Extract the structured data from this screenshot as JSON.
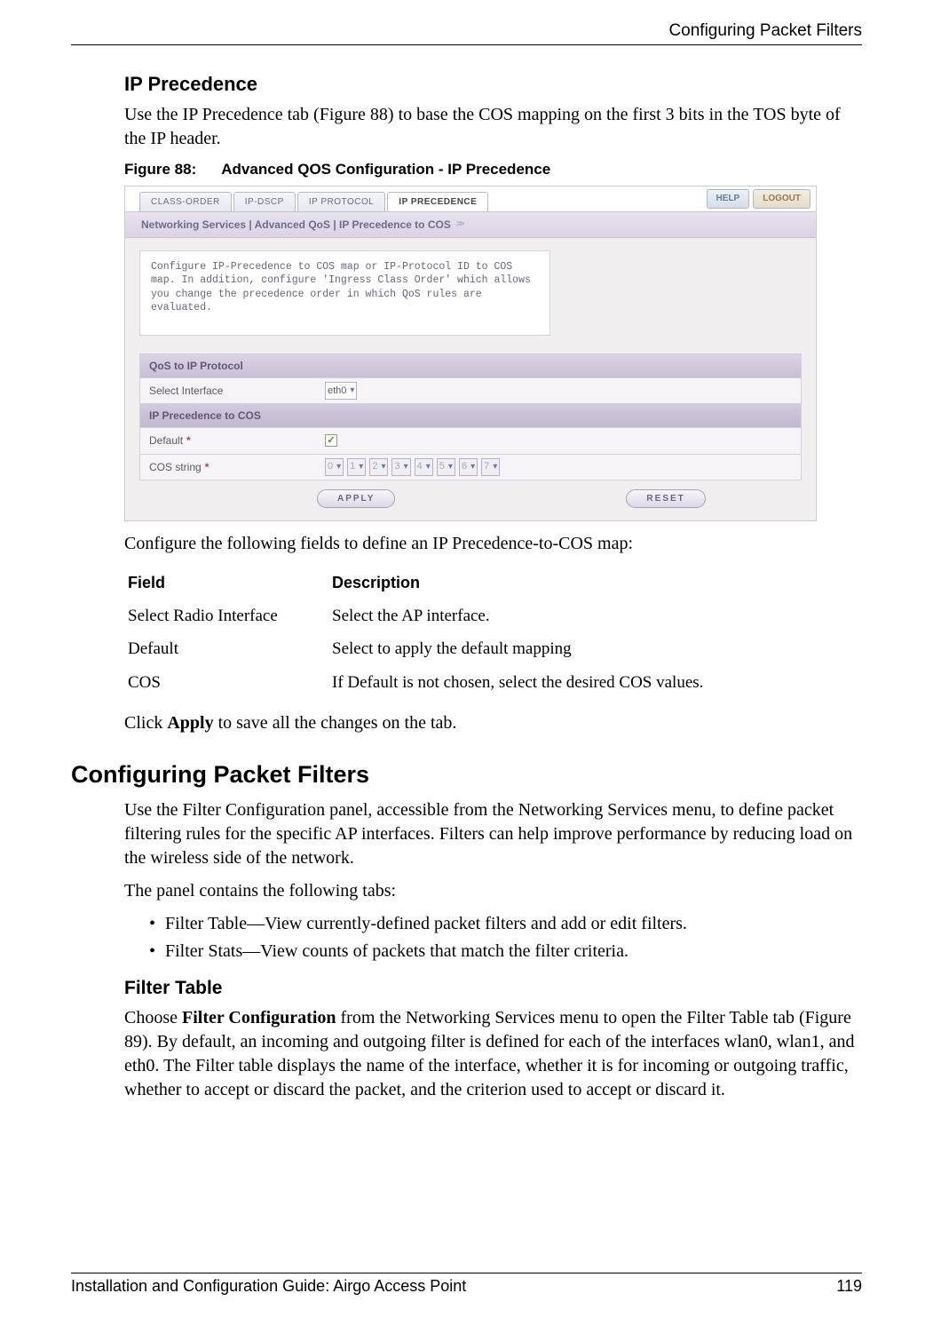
{
  "header": {
    "running_title": "Configuring Packet Filters"
  },
  "ipprec": {
    "heading": "IP Precedence",
    "intro": "Use the IP Precedence tab (Figure 88) to base the COS mapping on the first 3 bits in the TOS byte of the IP header.",
    "fig_no": "Figure 88:",
    "fig_title": "Advanced QOS Configuration - IP Precedence"
  },
  "shot": {
    "tabs": {
      "t1": "CLASS-ORDER",
      "t2": "IP-DSCP",
      "t3": "IP PROTOCOL",
      "t4": "IP PRECEDENCE"
    },
    "help": "HELP",
    "logout": "LOGOUT",
    "crumb": "Networking Services | Advanced QoS | IP Precedence to COS",
    "crumb_arrow": ">>",
    "info": "Configure IP-Precedence to COS map or IP-Protocol ID to COS map. In addition, configure 'Ingress Class Order' which allows you change the precedence order in which QoS rules are evaluated.",
    "sect1": "QoS to IP Protocol",
    "row_iface_label": "Select Interface",
    "row_iface_value": "eth0",
    "sect2": "IP Precedence to COS",
    "row_default_label": "Default",
    "row_cos_label": "COS string",
    "cos_values": [
      "0",
      "1",
      "2",
      "3",
      "4",
      "5",
      "6",
      "7"
    ],
    "apply": "APPLY",
    "reset": "RESET"
  },
  "aftershot": {
    "line": "Configure the following fields to define an IP Precedence-to-COS map:",
    "th_field": "Field",
    "th_desc": "Description",
    "r1f": "Select Radio Interface",
    "r1d": "Select the AP interface.",
    "r2f": "Default",
    "r2d": "Select to apply the default mapping",
    "r3f": "COS",
    "r3d": "If Default is not chosen, select the desired COS values.",
    "apply_line_pre": "Click ",
    "apply_bold": "Apply",
    "apply_line_post": " to save all the changes on the tab."
  },
  "cpf": {
    "heading": "Configuring Packet Filters",
    "p1": "Use the Filter Configuration panel, accessible from the Networking Services menu, to define packet filtering rules for the specific AP interfaces. Filters can help improve performance by reducing load on the wireless side of the network.",
    "p2": "The panel contains the following tabs:",
    "b1": "Filter Table—View currently-defined packet filters and add or edit filters.",
    "b2": "Filter Stats—View counts of packets that match the filter criteria.",
    "sub": "Filter Table",
    "p3a": "Choose ",
    "p3bold": "Filter Configuration",
    "p3b": " from the Networking Services menu to open the Filter Table tab (Figure 89). By default, an incoming and outgoing filter is defined for each of the interfaces wlan0, wlan1, and eth0. The Filter table displays the name of the interface, whether it is for incoming or outgoing traffic, whether to accept or discard the packet, and the criterion used to accept or discard it."
  },
  "footer": {
    "left": "Installation and Configuration Guide: Airgo Access Point",
    "right": "119"
  }
}
